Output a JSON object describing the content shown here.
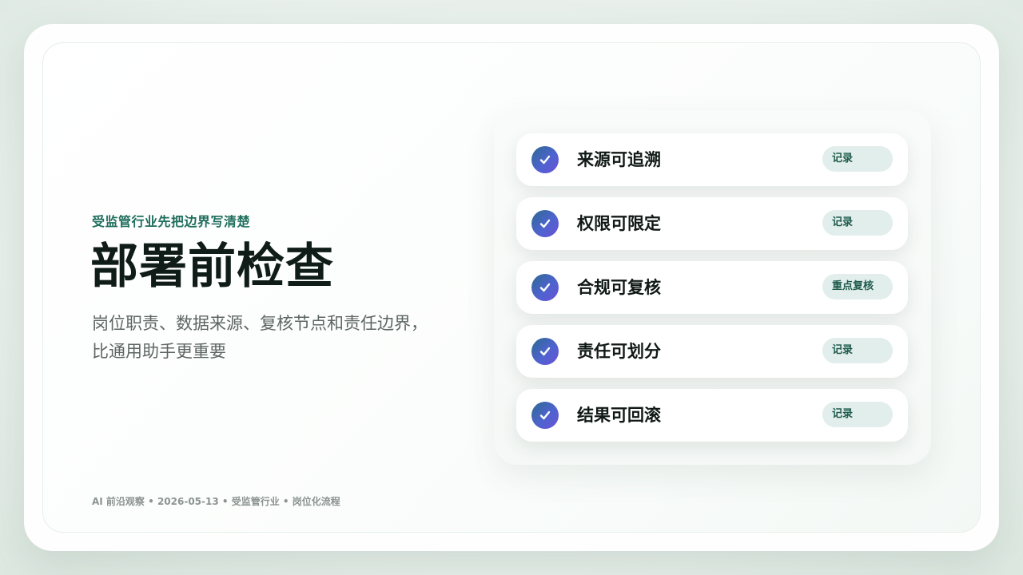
{
  "eyebrow": "受监管行业先把边界写清楚",
  "title": "部署前检查",
  "subtitle": {
    "line1": "岗位职责、数据来源、复核节点和责任边界，",
    "line2": "比通用助手更重要"
  },
  "footer": "AI 前沿观察 • 2026-05-13 • 受监管行业 • 岗位化流程",
  "checklist": [
    {
      "label": "来源可追溯",
      "tag": "记录",
      "icon": "check-icon"
    },
    {
      "label": "权限可限定",
      "tag": "记录",
      "icon": "check-icon"
    },
    {
      "label": "合规可复核",
      "tag": "重点复核",
      "icon": "check-icon"
    },
    {
      "label": "责任可划分",
      "tag": "记录",
      "icon": "check-icon"
    },
    {
      "label": "结果可回滚",
      "tag": "记录",
      "icon": "check-icon"
    }
  ],
  "colors": {
    "accent_green": "#1f6e5d",
    "check_gradient_start": "#2c6a8f",
    "check_gradient_end": "#6a52d6",
    "tag_background": "#e2eeeb"
  }
}
